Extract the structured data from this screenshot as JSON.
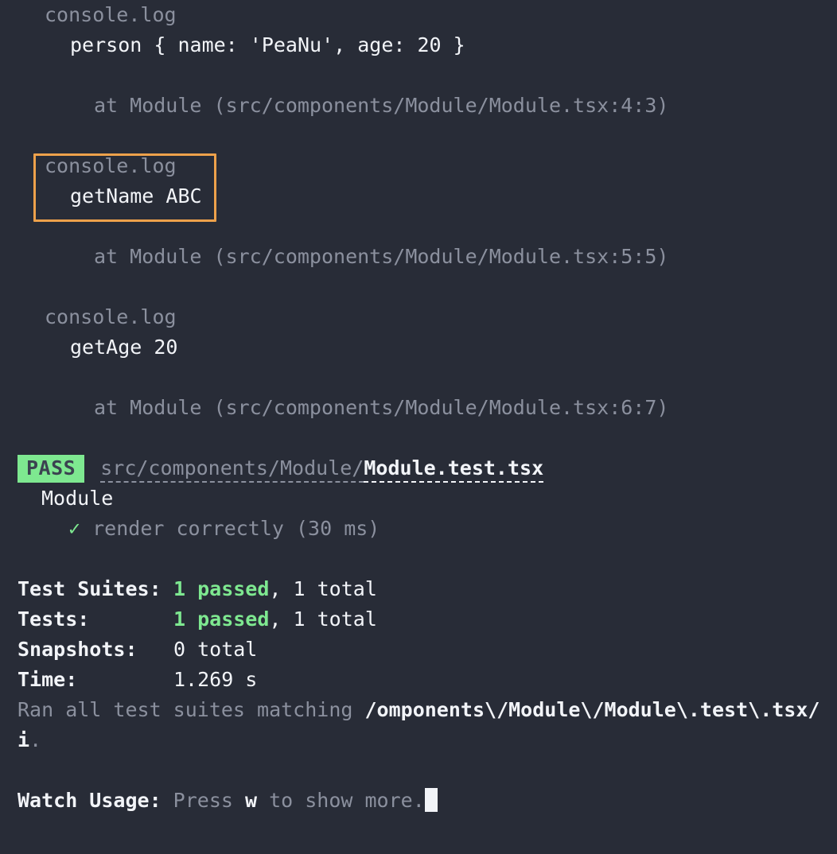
{
  "terminal": {
    "background_color": "#282c37",
    "foreground_color": "#f2f4f8",
    "dim_color": "#8b909e",
    "accent_green": "#7ee890",
    "highlight_border_color": "#eda14b"
  },
  "console_logs": [
    {
      "title": "console.log",
      "value": "person { name: 'PeaNu', age: 20 }",
      "stack": "at Module (src/components/Module/Module.tsx:4:3)",
      "highlighted": false
    },
    {
      "title": "console.log",
      "value": "getName ABC",
      "stack": "at Module (src/components/Module/Module.tsx:5:5)",
      "highlighted": true
    },
    {
      "title": "console.log",
      "value": "getAge 20",
      "stack": "at Module (src/components/Module/Module.tsx:6:7)",
      "highlighted": false
    }
  ],
  "suite": {
    "status_badge": "PASS",
    "path_dir": "src/components/Module/",
    "path_file": "Module.test.tsx",
    "describe_name": "Module",
    "tests": [
      {
        "icon": "check-icon",
        "icon_glyph": "✓",
        "label": "render correctly (30 ms)"
      }
    ]
  },
  "summary": {
    "rows": [
      {
        "label": "Test Suites:",
        "passed": "1 passed",
        "rest": ", 1 total",
        "has_passed": true
      },
      {
        "label": "Tests:",
        "passed": "1 passed",
        "rest": ", 1 total",
        "has_passed": true
      },
      {
        "label": "Snapshots:",
        "passed": "",
        "rest": "0 total",
        "has_passed": false
      },
      {
        "label": "Time:",
        "passed": "",
        "rest": "1.269 s",
        "has_passed": false
      }
    ],
    "ran_prefix": "Ran all test suites matching ",
    "ran_pattern": "/omponents\\/Module\\/Module\\.test\\.tsx/i",
    "ran_suffix": "."
  },
  "watch": {
    "label": "Watch Usage:",
    "text_before": " Press ",
    "key": "w",
    "text_after": " to show more."
  }
}
